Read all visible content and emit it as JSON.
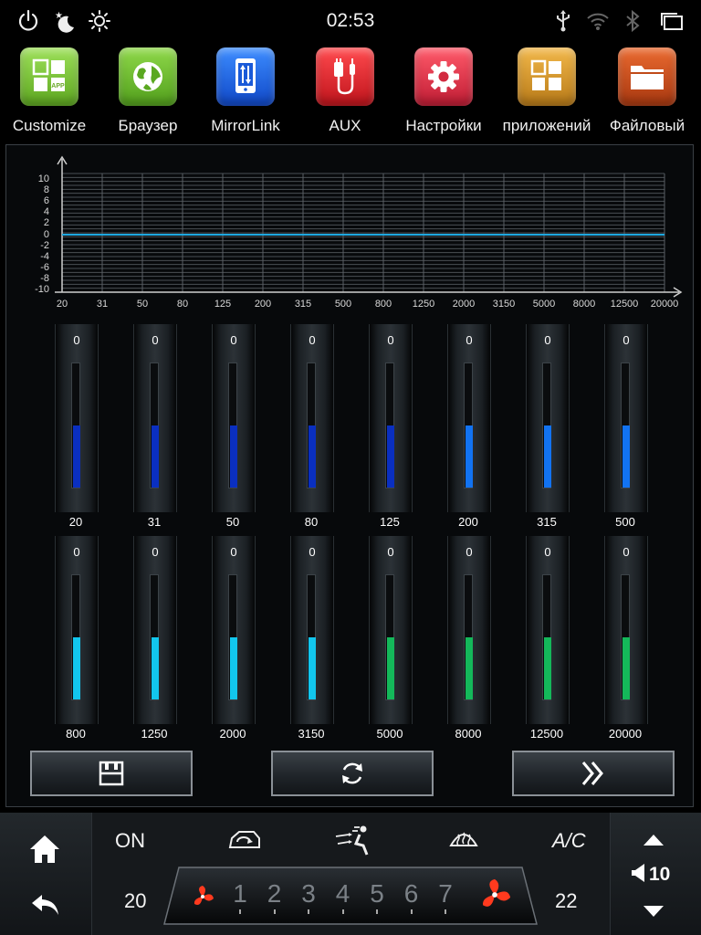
{
  "status_bar": {
    "clock": "02:53",
    "left_icons": [
      "power-icon",
      "night-mode-icon",
      "brightness-icon"
    ],
    "right_icons": [
      "usb-icon",
      "wifi-icon",
      "bluetooth-icon",
      "recent-apps-icon"
    ]
  },
  "apps": [
    {
      "label": "Customize",
      "icon": "customize-icon",
      "color": "#7cc83a"
    },
    {
      "label": "Браузер",
      "icon": "globe-icon",
      "color": "#6ebe2e"
    },
    {
      "label": "MirrorLink",
      "icon": "phone-link-icon",
      "color": "#1e6fe0"
    },
    {
      "label": "AUX",
      "icon": "aux-cable-icon",
      "color": "#e0232b"
    },
    {
      "label": "Настройки",
      "icon": "gear-icon",
      "color": "#e0354a"
    },
    {
      "label": "приложений",
      "icon": "apps-grid-icon",
      "color": "#d99a2e"
    },
    {
      "label": "Файловый",
      "icon": "folder-icon",
      "color": "#c8501c"
    }
  ],
  "customize_badge": "APP",
  "equalizer": {
    "y_ticks": [
      "10",
      "8",
      "6",
      "4",
      "2",
      "0",
      "-2",
      "-4",
      "-6",
      "-8",
      "-10"
    ],
    "x_ticks": [
      "20",
      "31",
      "50",
      "80",
      "125",
      "200",
      "315",
      "500",
      "800",
      "1250",
      "2000",
      "3150",
      "5000",
      "8000",
      "12500",
      "20000"
    ],
    "curve_value": 0,
    "curve_color": "#1ea8e0",
    "bands": [
      {
        "freq": "20",
        "value": "0",
        "level": 0.5,
        "color": "#0a2fc0"
      },
      {
        "freq": "31",
        "value": "0",
        "level": 0.5,
        "color": "#0a2fc0"
      },
      {
        "freq": "50",
        "value": "0",
        "level": 0.5,
        "color": "#0a2fc0"
      },
      {
        "freq": "80",
        "value": "0",
        "level": 0.5,
        "color": "#0a2fc0"
      },
      {
        "freq": "125",
        "value": "0",
        "level": 0.5,
        "color": "#0a2fc0"
      },
      {
        "freq": "200",
        "value": "0",
        "level": 0.5,
        "color": "#1273f2"
      },
      {
        "freq": "315",
        "value": "0",
        "level": 0.5,
        "color": "#1273f2"
      },
      {
        "freq": "500",
        "value": "0",
        "level": 0.5,
        "color": "#1273f2"
      },
      {
        "freq": "800",
        "value": "0",
        "level": 0.5,
        "color": "#12c6ee"
      },
      {
        "freq": "1250",
        "value": "0",
        "level": 0.5,
        "color": "#12c6ee"
      },
      {
        "freq": "2000",
        "value": "0",
        "level": 0.5,
        "color": "#12c6ee"
      },
      {
        "freq": "3150",
        "value": "0",
        "level": 0.5,
        "color": "#12c6ee"
      },
      {
        "freq": "5000",
        "value": "0",
        "level": 0.5,
        "color": "#14b85a"
      },
      {
        "freq": "8000",
        "value": "0",
        "level": 0.5,
        "color": "#14b85a"
      },
      {
        "freq": "12500",
        "value": "0",
        "level": 0.5,
        "color": "#14b85a"
      },
      {
        "freq": "20000",
        "value": "0",
        "level": 0.5,
        "color": "#14b85a"
      }
    ],
    "actions": [
      {
        "name": "save-button",
        "icon": "save-icon"
      },
      {
        "name": "reset-button",
        "icon": "refresh-icon"
      },
      {
        "name": "next-button",
        "icon": "double-chevron-right-icon"
      }
    ]
  },
  "climate": {
    "power_label": "ON",
    "ac_label": "A/C",
    "left_temp": "20",
    "right_temp": "22",
    "fan_levels": [
      "1",
      "2",
      "3",
      "4",
      "5",
      "6",
      "7"
    ],
    "volume": "10",
    "icons": [
      "home-icon",
      "back-icon",
      "recirculation-icon",
      "airflow-mode-icon",
      "rear-defrost-icon",
      "volume-up-icon",
      "volume-down-icon",
      "speaker-icon"
    ]
  }
}
